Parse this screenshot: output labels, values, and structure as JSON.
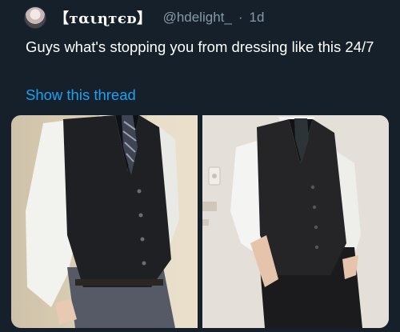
{
  "tweet": {
    "display_name": "【ᴛαιɳтєᴅ】",
    "handle": "@hdelight_",
    "separator": "·",
    "time": "1d",
    "text": "Guys what's stopping you from dressing like this 24/7",
    "show_thread_label": "Show this thread"
  },
  "icons": {
    "avatar": "profile-avatar"
  },
  "colors": {
    "background": "#15202b",
    "text": "#ffffff",
    "secondary_text": "#8899a6",
    "link": "#1da1f2"
  }
}
